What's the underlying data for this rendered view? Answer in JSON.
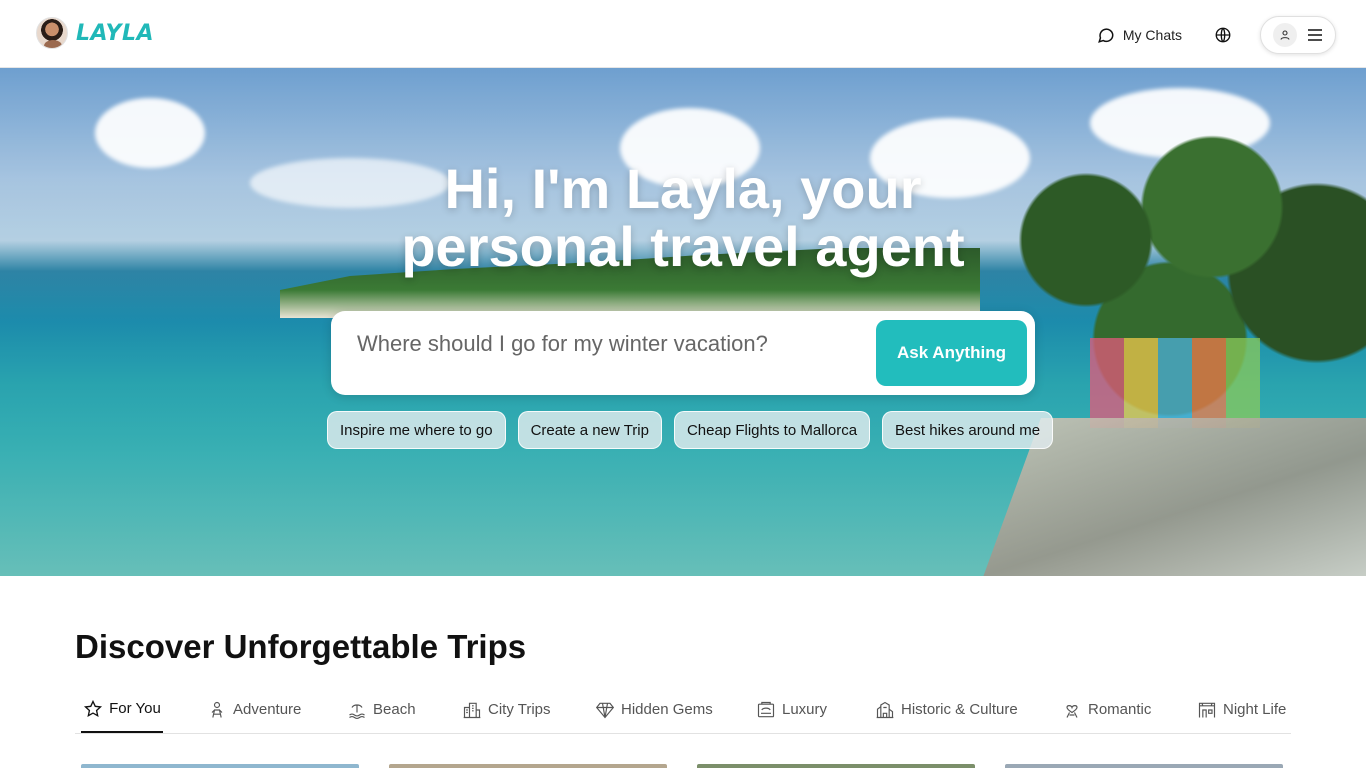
{
  "header": {
    "brand": "LAYLA",
    "my_chats_label": "My Chats"
  },
  "hero": {
    "title_line1": "Hi, I'm Layla, your",
    "title_line2": "personal travel agent",
    "search_placeholder": "Where should I go for my winter vacation?",
    "ask_button": "Ask Anything",
    "chips": [
      "Inspire me where to go",
      "Create a new Trip",
      "Cheap Flights to Mallorca",
      "Best hikes around me"
    ]
  },
  "discover": {
    "title": "Discover Unforgettable Trips",
    "tabs": [
      {
        "label": "For You",
        "icon": "star-icon",
        "active": true
      },
      {
        "label": "Adventure",
        "icon": "adventure-icon",
        "active": false
      },
      {
        "label": "Beach",
        "icon": "beach-icon",
        "active": false
      },
      {
        "label": "City Trips",
        "icon": "city-icon",
        "active": false
      },
      {
        "label": "Hidden Gems",
        "icon": "gem-icon",
        "active": false
      },
      {
        "label": "Luxury",
        "icon": "luxury-icon",
        "active": false
      },
      {
        "label": "Historic & Culture",
        "icon": "historic-icon",
        "active": false
      },
      {
        "label": "Romantic",
        "icon": "romantic-icon",
        "active": false
      },
      {
        "label": "Night Life",
        "icon": "nightlife-icon",
        "active": false
      }
    ]
  },
  "colors": {
    "accent": "#22bdbd",
    "brand": "#21b8b8"
  }
}
